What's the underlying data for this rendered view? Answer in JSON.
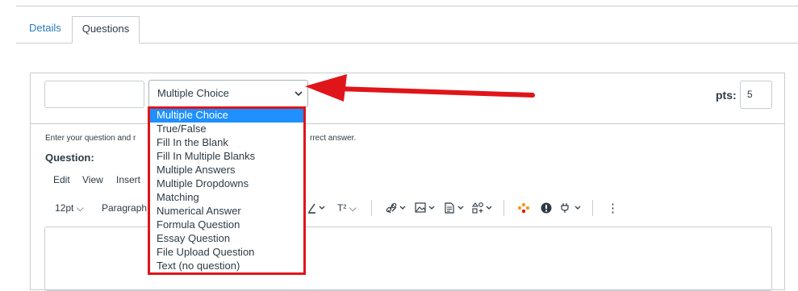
{
  "tabs": [
    {
      "label": "Details"
    },
    {
      "label": "Questions"
    }
  ],
  "question": {
    "name_value": "",
    "type_selected": "Multiple Choice",
    "pts_label": "pts:",
    "pts_value": "5",
    "instructions_start": "Enter your question and r",
    "instructions_end": "rrect answer.",
    "question_label": "Question:"
  },
  "editor_menu": [
    "Edit",
    "View",
    "Insert"
  ],
  "toolbar": {
    "font_size": "12pt",
    "paragraph": "Paragraph",
    "superscript": "T²",
    "more": "⋮"
  },
  "type_options": [
    "Multiple Choice",
    "True/False",
    "Fill In the Blank",
    "Fill In Multiple Blanks",
    "Multiple Answers",
    "Multiple Dropdowns",
    "Matching",
    "Numerical Answer",
    "Formula Question",
    "Essay Question",
    "File Upload Question",
    "Text (no question)"
  ],
  "colors": {
    "highlight": "#1e90ff",
    "annotation": "#e0151a",
    "link": "#2b7abc"
  }
}
